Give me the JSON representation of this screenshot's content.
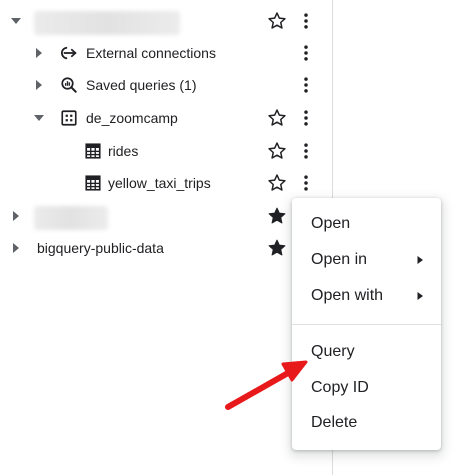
{
  "tree": {
    "rows": [
      {
        "id": "project-1",
        "label": "",
        "redacted": true,
        "expanded": true,
        "starred": false
      },
      {
        "id": "external-connections",
        "label": "External connections",
        "icon": "external-connection-icon"
      },
      {
        "id": "saved-queries",
        "label": "Saved queries (1)",
        "icon": "saved-query-icon"
      },
      {
        "id": "dataset",
        "label": "de_zoomcamp",
        "icon": "dataset-icon",
        "expanded": true,
        "starred": false
      },
      {
        "id": "table-rides",
        "label": "rides",
        "icon": "table-icon",
        "starred": false
      },
      {
        "id": "table-yellow",
        "label": "yellow_taxi_trips",
        "icon": "table-icon",
        "starred": false
      },
      {
        "id": "project-2",
        "label": "",
        "redacted": true,
        "expanded": false,
        "starred": true
      },
      {
        "id": "public-data",
        "label": "bigquery-public-data",
        "expanded": false,
        "starred": true
      }
    ]
  },
  "context_menu": {
    "items": [
      {
        "label": "Open"
      },
      {
        "label": "Open in",
        "has_submenu": true
      },
      {
        "label": "Open with",
        "has_submenu": true
      },
      {
        "label": "Query"
      },
      {
        "label": "Copy ID"
      },
      {
        "label": "Delete"
      }
    ]
  },
  "colors": {
    "text": "#202124",
    "icon": "#202124",
    "divider": "#dadce0",
    "annotation_arrow": "#e8191b"
  }
}
